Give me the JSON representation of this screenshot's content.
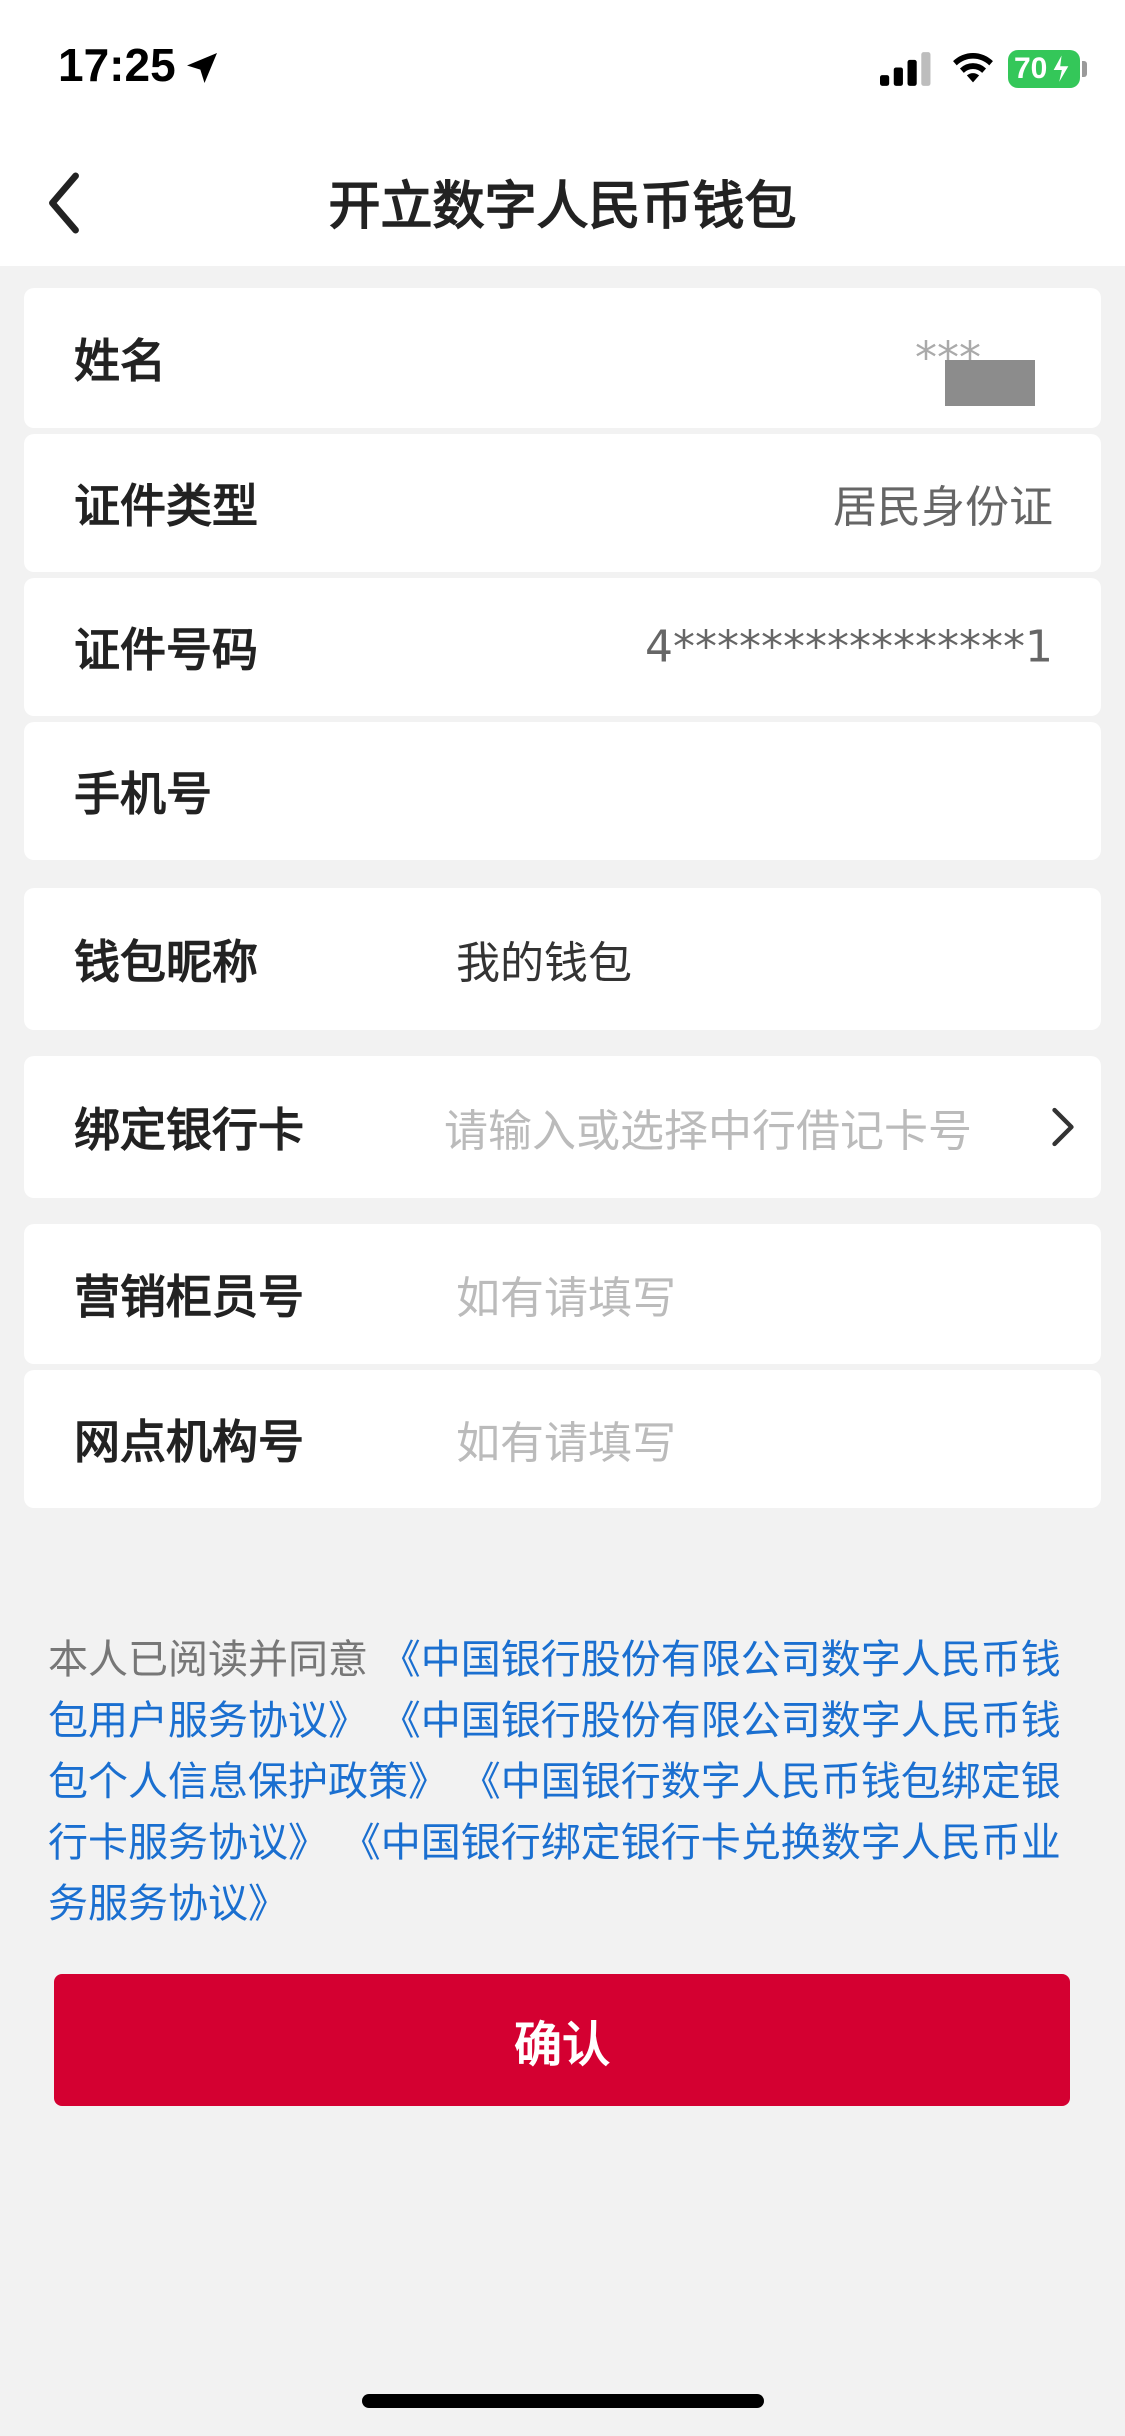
{
  "status_bar": {
    "time": "17:25",
    "battery": "70",
    "icons": [
      "location-arrow-icon",
      "cellular-signal-icon",
      "wifi-icon",
      "battery-charging-icon"
    ]
  },
  "header": {
    "title": "开立数字人民币钱包",
    "back_icon": "chevron-left-icon"
  },
  "form": {
    "name": {
      "label": "姓名",
      "value": "***"
    },
    "id_type": {
      "label": "证件类型",
      "value": "居民身份证"
    },
    "id_number": {
      "label": "证件号码",
      "value": "4****************1"
    },
    "phone": {
      "label": "手机号",
      "value": ""
    },
    "wallet_nickname": {
      "label": "钱包昵称",
      "value": "我的钱包"
    },
    "bank_card": {
      "label": "绑定银行卡",
      "placeholder": "请输入或选择中行借记卡号",
      "icon": "chevron-right-icon"
    },
    "teller_no": {
      "label": "营销柜员号",
      "placeholder": "如有请填写"
    },
    "branch_no": {
      "label": "网点机构号",
      "placeholder": "如有请填写"
    }
  },
  "agreement": {
    "prefix": "本人已阅读并同意",
    "links": [
      "《中国银行股份有限公司数字人民币钱包用户服务协议》",
      "《中国银行股份有限公司数字人民币钱包个人信息保护政策》",
      "《中国银行数字人民币钱包绑定银行卡服务协议》",
      "《中国银行绑定银行卡兑换数字人民币业务服务协议》"
    ]
  },
  "confirm_button": {
    "label": "确认"
  },
  "colors": {
    "accent_red": "#d40031",
    "link_blue": "#1a6fd0",
    "battery_green": "#34c759",
    "page_bg": "#f2f2f2"
  }
}
